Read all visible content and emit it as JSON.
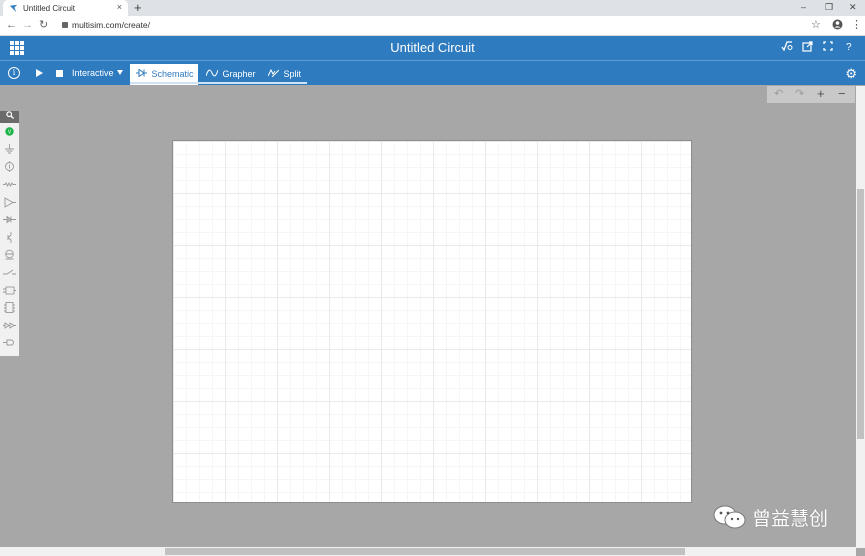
{
  "browser": {
    "tab_title": "Untitled Circuit",
    "tab_close": "×",
    "new_tab": "+",
    "minimize": "–",
    "restore": "❐",
    "close": "✕",
    "url": "multisim.com/create/",
    "back_icon": "←",
    "forward_icon": "→",
    "reload_icon": "↻",
    "bookmark_icon": "☆",
    "menu_icon": "⋮"
  },
  "header": {
    "title": "Untitled Circuit",
    "icons": [
      "sqrt-icon",
      "export-icon",
      "fullscreen-icon",
      "help-icon"
    ]
  },
  "toolbar": {
    "mode_label": "Interactive",
    "tabs": [
      {
        "label": "Schematic",
        "active": true
      },
      {
        "label": "Grapher",
        "active": false
      },
      {
        "label": "Split",
        "active": false
      }
    ]
  },
  "zoom": {
    "undo": "↶",
    "redo": "↷",
    "zoom_in": "+",
    "zoom_out": "−"
  },
  "palette": {
    "search_icon": "magnifier-icon",
    "items": [
      "probe-icon",
      "ground-icon",
      "source-icon",
      "resistor-icon",
      "amplifier-icon",
      "diode-icon",
      "transistor-icon",
      "meter-icon",
      "switch-icon",
      "gate-icon",
      "ic-icon",
      "logic-icon",
      "connector-icon"
    ]
  },
  "watermark": {
    "text": "曾益慧创"
  },
  "colors": {
    "brand_blue": "#2e7bbf",
    "workspace_gray": "#a7a7a7",
    "probe_green": "#1db34a"
  }
}
